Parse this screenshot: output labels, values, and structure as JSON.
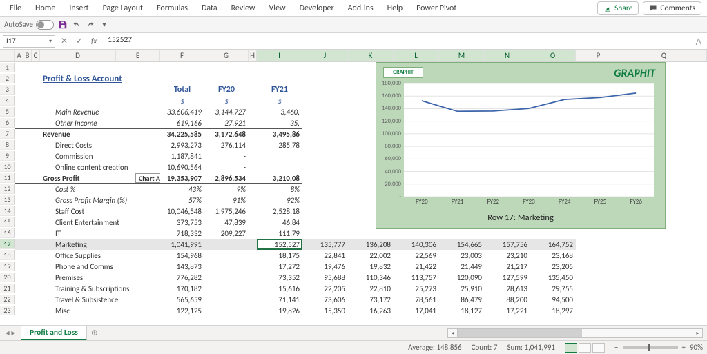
{
  "ribbon": {
    "tabs": [
      "File",
      "Home",
      "Insert",
      "Page Layout",
      "Formulas",
      "Data",
      "Review",
      "View",
      "Developer",
      "Add-ins",
      "Help",
      "Power Pivot"
    ],
    "share": "Share",
    "comments": "Comments"
  },
  "qat": {
    "autosave": "AutoSave"
  },
  "formula": {
    "name_box": "I17",
    "fx": "fx",
    "value": "152527"
  },
  "col_headers_small": [
    "A",
    "B",
    "C"
  ],
  "col_headers_mid": [
    "D",
    "E",
    "F",
    "G",
    "H"
  ],
  "col_headers_num": [
    "I",
    "J",
    "K",
    "L",
    "M",
    "N",
    "O",
    "P"
  ],
  "col_trailing": "Q",
  "sheet": {
    "title": "Profit & Loss Account",
    "col_titles": {
      "total": "Total",
      "fy20": "FY20",
      "fy21": "FY21"
    },
    "unit": "$",
    "chart_area_label": "Chart Area",
    "rows": {
      "main_revenue": {
        "label": "Main Revenue",
        "total": "33,606,419",
        "fy20": "3,144,727",
        "fy21": "3,460,"
      },
      "other_income": {
        "label": "Other Income",
        "total": "619,166",
        "fy20": "27,921",
        "fy21": "35,"
      },
      "revenue": {
        "label": "Revenue",
        "total": "34,225,585",
        "fy20": "3,172,648",
        "fy21": "3,495,86"
      },
      "direct_costs": {
        "label": "Direct Costs",
        "total": "2,993,273",
        "fy20": "276,114",
        "fy21": "285,78"
      },
      "commission": {
        "label": "Commission",
        "total": "1,187,841",
        "fy20": "-",
        "fy21": ""
      },
      "online_content": {
        "label": "Online content creation",
        "total": "10,690,564",
        "fy20": "-",
        "fy21": ""
      },
      "gross_profit": {
        "label": "Gross Profit",
        "total": "19,353,907",
        "fy20": "2,896,534",
        "fy21": "3,210,08"
      },
      "cost_pct": {
        "label": "Cost %",
        "total": "43%",
        "fy20": "9%",
        "fy21": "8%"
      },
      "gp_margin": {
        "label": "Gross Profit Margin (%)",
        "total": "57%",
        "fy20": "91%",
        "fy21": "92%"
      },
      "staff_cost": {
        "label": "Staff Cost",
        "total": "10,046,548",
        "fy20": "1,975,246",
        "fy21": "2,528,18"
      },
      "client_ent": {
        "label": "Client Entertainment",
        "total": "373,753",
        "fy20": "47,839",
        "fy21": "46,84"
      },
      "it": {
        "label": "IT",
        "total": "718,332",
        "fy20": "209,227",
        "fy21": "111,79"
      },
      "marketing": {
        "label": "Marketing",
        "total": "1,041,991",
        "fy": [
          "152,527",
          "135,777",
          "136,208",
          "140,306",
          "154,665",
          "157,756",
          "164,752"
        ]
      },
      "office_supplies": {
        "label": "Office Supplies",
        "total": "154,968",
        "fy": [
          "18,175",
          "22,841",
          "22,002",
          "22,569",
          "23,003",
          "23,210",
          "23,168"
        ]
      },
      "phone_comms": {
        "label": "Phone and Comms",
        "total": "143,873",
        "fy": [
          "17,272",
          "19,476",
          "19,832",
          "21,422",
          "21,449",
          "21,217",
          "23,205"
        ]
      },
      "premises": {
        "label": "Premises",
        "total": "776,282",
        "fy": [
          "73,352",
          "95,688",
          "110,346",
          "113,757",
          "120,090",
          "127,599",
          "135,450"
        ]
      },
      "training": {
        "label": "Training & Subscriptions",
        "total": "170,182",
        "fy": [
          "15,616",
          "22,205",
          "22,810",
          "25,273",
          "25,910",
          "28,613",
          "29,755"
        ]
      },
      "travel": {
        "label": "Travel & Subsistence",
        "total": "565,659",
        "fy": [
          "71,141",
          "73,606",
          "73,172",
          "78,561",
          "86,479",
          "88,200",
          "94,500"
        ]
      },
      "misc": {
        "label": "Misc",
        "total": "122,125",
        "fy": [
          "19,826",
          "15,350",
          "16,263",
          "17,041",
          "18,127",
          "17,221",
          "18,297"
        ]
      }
    }
  },
  "chart_data": {
    "type": "line",
    "title": "GRAPHIT",
    "caption": "Row 17: Marketing",
    "logo": "GRAPHIT",
    "xlabel": "",
    "ylabel": "",
    "ylim": [
      0,
      180000
    ],
    "yticks": [
      "-",
      "20,000",
      "40,000",
      "60,000",
      "80,000",
      "100,000",
      "120,000",
      "140,000",
      "160,000",
      "180,000"
    ],
    "categories": [
      "FY20",
      "FY21",
      "FY22",
      "FY23",
      "FY24",
      "FY25",
      "FY26"
    ],
    "series": [
      {
        "name": "Marketing",
        "values": [
          152527,
          135777,
          136208,
          140306,
          154665,
          157756,
          164752
        ]
      }
    ]
  },
  "tabs": {
    "active": "Profit and Loss"
  },
  "status": {
    "avg": "Average: 148,856",
    "count": "Count: 7",
    "sum": "Sum: 1,041,991",
    "zoom": "90%"
  }
}
